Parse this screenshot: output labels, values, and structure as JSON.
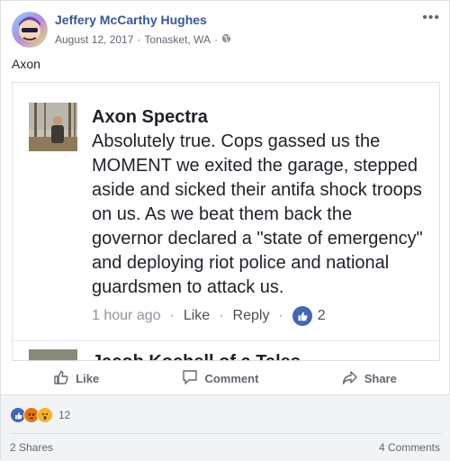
{
  "post": {
    "author": "Jeffery McCarthy Hughes",
    "date": "August 12, 2017",
    "separator": "·",
    "location": "Tonasket, WA",
    "privacy_icon": "globe-icon",
    "more_label": "•••",
    "text": "Axon"
  },
  "comment": {
    "author": "Axon Spectra",
    "body": "Absolutely true. Cops gassed us the MOMENT we exited the garage, stepped aside and sicked their antifa shock troops on us. As we beat them back the governor declared a \"state of emergency\" and deploying riot police and national guardsmen to attack us.",
    "time": "1 hour ago",
    "like_label": "Like",
    "reply_label": "Reply",
    "separator": "·",
    "like_count": "2",
    "next_author_partial": "Jacob Kochell of a Tales"
  },
  "actions": {
    "like": "Like",
    "comment": "Comment",
    "share": "Share"
  },
  "summary": {
    "reaction_count": "12",
    "shares": "2 Shares",
    "comments": "4 Comments"
  },
  "colors": {
    "brand_blue": "#365899",
    "like_blue": "#4267b2",
    "angry": "#e9710f",
    "wow": "#f7b125"
  }
}
